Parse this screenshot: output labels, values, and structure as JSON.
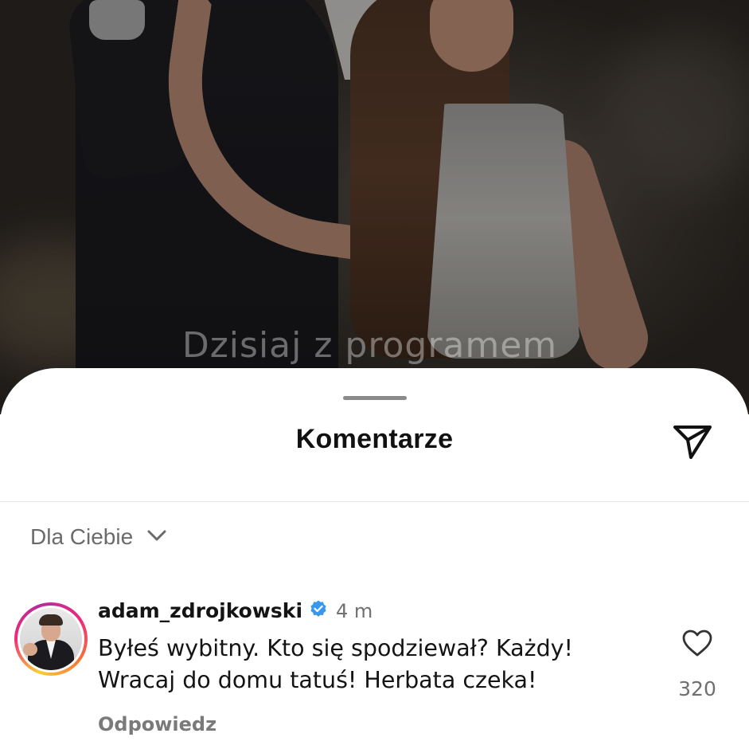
{
  "media": {
    "caption": "Dzisiaj z programem"
  },
  "sheet": {
    "title": "Komentarze"
  },
  "filter": {
    "label": "Dla Ciebie"
  },
  "comment": {
    "username": "adam_zdrojkowski",
    "verified": true,
    "time": "4 m",
    "text": "Byłeś wybitny. Kto się spodziewał? Każdy!\nWracaj do domu tatuś! Herbata czeka!",
    "reply_label": "Odpowiedz",
    "likes": "320"
  },
  "icons": {
    "share": "paper-plane-icon",
    "filter_toggle": "chevron-down-icon",
    "verified": "verified-badge-icon",
    "like": "heart-icon"
  },
  "colors": {
    "verified_blue": "#3897f0",
    "sheet_bg": "#ffffff",
    "text_primary": "#141414",
    "text_secondary": "#707070"
  }
}
